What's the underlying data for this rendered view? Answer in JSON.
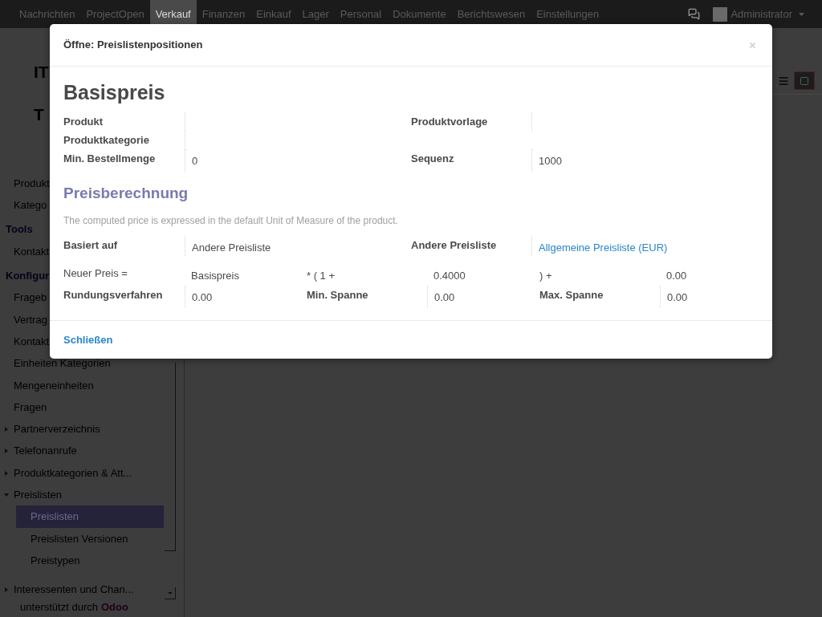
{
  "top_nav": {
    "menus": [
      {
        "label": "Nachrichten",
        "selected": false
      },
      {
        "label": "ProjectOpen",
        "selected": false
      },
      {
        "label": "Verkauf",
        "selected": true
      },
      {
        "label": "Finanzen",
        "selected": false
      },
      {
        "label": "Einkauf",
        "selected": false
      },
      {
        "label": "Lager",
        "selected": false
      },
      {
        "label": "Personal",
        "selected": false
      },
      {
        "label": "Dokumente",
        "selected": false
      },
      {
        "label": "Berichtswesen",
        "selected": false
      },
      {
        "label": "Einstellungen",
        "selected": false
      }
    ],
    "user": "Administrator"
  },
  "page_title": [
    "IT",
    "T"
  ],
  "sidebar": {
    "items": [
      {
        "kind": "item",
        "label": "Produkt",
        "selected": false
      },
      {
        "kind": "item",
        "label": "Katego",
        "selected": false
      },
      {
        "kind": "header",
        "label": "Tools"
      },
      {
        "kind": "item",
        "label": "Kontakt",
        "selected": false
      },
      {
        "kind": "header",
        "label": "Konfigur"
      },
      {
        "kind": "item",
        "label": "Frageb",
        "selected": false
      },
      {
        "kind": "item",
        "label": "Vertrag",
        "selected": false
      },
      {
        "kind": "item",
        "label": "Kontakt",
        "selected": false
      },
      {
        "kind": "item",
        "label": "Einheiten Kategorien",
        "selected": false
      },
      {
        "kind": "item",
        "label": "Mengeneinheiten",
        "selected": false
      },
      {
        "kind": "item",
        "label": "Fragen",
        "selected": false
      },
      {
        "kind": "group",
        "label": "Partnerverzeichnis",
        "expanded": false
      },
      {
        "kind": "group",
        "label": "Telefonanrufe",
        "expanded": false
      },
      {
        "kind": "group",
        "label": "Produktkategorien & Att...",
        "expanded": false
      },
      {
        "kind": "group",
        "label": "Preislisten",
        "expanded": true,
        "children": [
          {
            "label": "Preislisten",
            "selected": true
          },
          {
            "label": "Preislisten Versionen",
            "selected": false
          },
          {
            "label": "Preistypen",
            "selected": false
          }
        ]
      },
      {
        "kind": "group",
        "label": "Interessenten und Chan...",
        "expanded": false
      }
    ],
    "footer": {
      "text": "unterstützt durch",
      "brand": "Odoo"
    }
  },
  "dialog": {
    "title": "Öffne: Preislistenpositionen",
    "heading": "Basispreis",
    "rows": [
      {
        "left": {
          "label": "Produkt"
        },
        "right": {
          "label": "Produktvorlage"
        }
      },
      {
        "left": {
          "label": "Produktkategorie"
        }
      },
      {
        "left": {
          "label": "Min. Bestellmenge",
          "value": "0"
        },
        "right": {
          "label": "Sequenz",
          "value": "1000"
        }
      }
    ],
    "section_title": "Preisberechnung",
    "help": "The computed price is expressed in the default Unit of Measure of the product.",
    "based_on_row": [
      {
        "label": "Basiert auf",
        "value": "Andere Preisliste",
        "kind": "text"
      },
      {
        "label": "Andere Preisliste",
        "value": "Allgemeine Preisliste (EUR)",
        "kind": "link"
      }
    ],
    "formula": {
      "label": "Neuer Preis =",
      "parts": [
        {
          "kind": "value",
          "text": "Basispreis"
        },
        {
          "kind": "operator",
          "text": "* ( 1 +"
        },
        {
          "kind": "value",
          "text": "0.4000"
        },
        {
          "kind": "operator",
          "text": ") +"
        },
        {
          "kind": "value",
          "text": "0.00"
        }
      ]
    },
    "margin_row": [
      {
        "label": "Rundungsverfahren",
        "value": "0.00"
      },
      {
        "label": "Min. Spanne",
        "value": "0.00"
      },
      {
        "label": "Max. Spanne",
        "value": "0.00"
      }
    ],
    "close_button": "Schließen"
  }
}
